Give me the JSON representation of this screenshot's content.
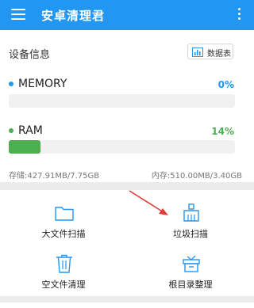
{
  "app": {
    "title": "安卓清理君",
    "menu_icon": "hamburger-icon",
    "overflow_icon": "more-vertical-icon"
  },
  "device": {
    "title": "设备信息",
    "data_button": {
      "icon": "bar-chart-icon",
      "label": "数据表"
    },
    "memory": {
      "label": "MEMORY",
      "percent": "0%",
      "usage_fraction": 0.0,
      "color": "#2196f3"
    },
    "ram": {
      "label": "RAM",
      "percent": "14%",
      "usage_fraction": 0.14,
      "color": "#4caf50"
    },
    "storage": "存储:427.91MB/7.75GB",
    "memory_capacity": "内存:510.00MB/3.40GB"
  },
  "tools": [
    {
      "label": "大文件扫描",
      "icon": "folder-icon"
    },
    {
      "label": "垃圾扫描",
      "icon": "broom-icon"
    },
    {
      "label": "空文件清理",
      "icon": "trash-icon"
    },
    {
      "label": "根目录整理",
      "icon": "toolbox-icon"
    }
  ],
  "colors": {
    "accent": "#2196f3",
    "memory_dot": "#2196f3",
    "ram": "#4caf50",
    "annotation_arrow": "#e53935"
  }
}
